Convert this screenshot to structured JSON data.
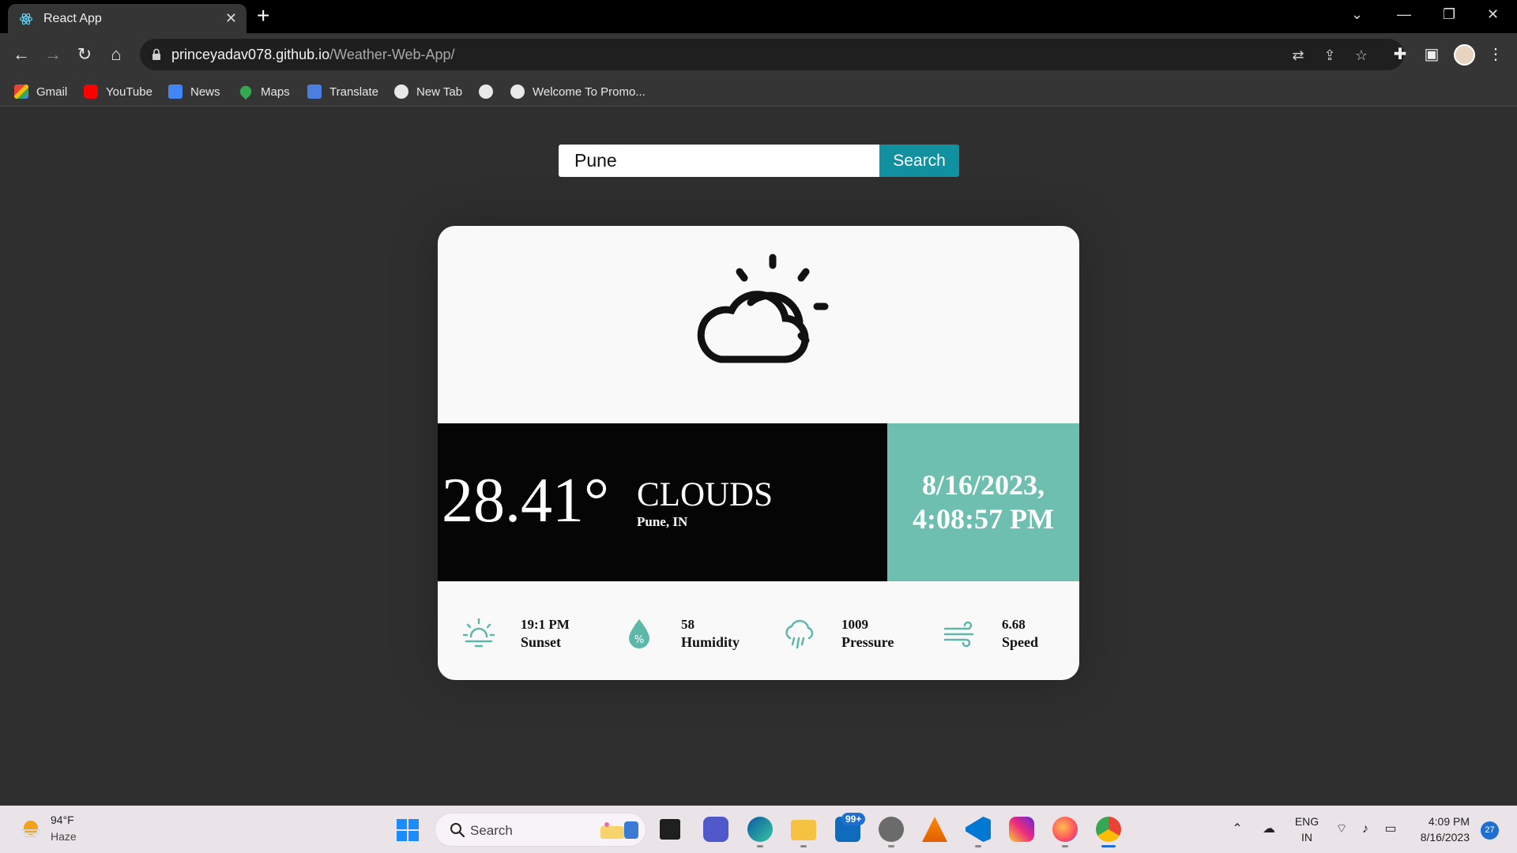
{
  "browser": {
    "tab_title": "React App",
    "tab_close": "✕",
    "new_tab": "+",
    "url_host": "princeyadav078.github.io",
    "url_path": "/Weather-Web-App/",
    "bookmarks": [
      {
        "label": "Gmail",
        "icon": "gmail-icon"
      },
      {
        "label": "YouTube",
        "icon": "youtube-icon"
      },
      {
        "label": "News",
        "icon": "news-icon"
      },
      {
        "label": "Maps",
        "icon": "maps-icon"
      },
      {
        "label": "Translate",
        "icon": "translate-icon"
      },
      {
        "label": "New Tab",
        "icon": "globe-icon"
      },
      {
        "label": "",
        "icon": "globe-icon"
      },
      {
        "label": "Welcome To Promo...",
        "icon": "globe-icon"
      }
    ]
  },
  "search": {
    "value": "Pune",
    "button_label": "Search"
  },
  "weather": {
    "icon": "partly-cloudy-icon",
    "temperature": "28.41°",
    "condition": "CLOUDS",
    "location": "Pune, IN",
    "date": "8/16/2023,",
    "time": "4:08:57 PM",
    "stats": [
      {
        "value": "19:1 PM",
        "label": "Sunset",
        "icon": "sunset-icon"
      },
      {
        "value": "58",
        "label": "Humidity",
        "icon": "humidity-icon"
      },
      {
        "value": "1009",
        "label": "Pressure",
        "icon": "pressure-icon"
      },
      {
        "value": "6.68",
        "label": "Speed",
        "icon": "wind-icon"
      }
    ],
    "colors": {
      "accent": "#11919f",
      "teal_panel": "#6fbfb1",
      "dark_panel": "#050505",
      "icon_teal": "#5db8a9"
    }
  },
  "taskbar": {
    "weather_temp": "94°F",
    "weather_desc": "Haze",
    "search_placeholder": "Search",
    "mail_badge": "99+",
    "lang_top": "ENG",
    "lang_bottom": "IN",
    "clock_time": "4:09 PM",
    "clock_date": "8/16/2023",
    "notification_count": "27"
  }
}
